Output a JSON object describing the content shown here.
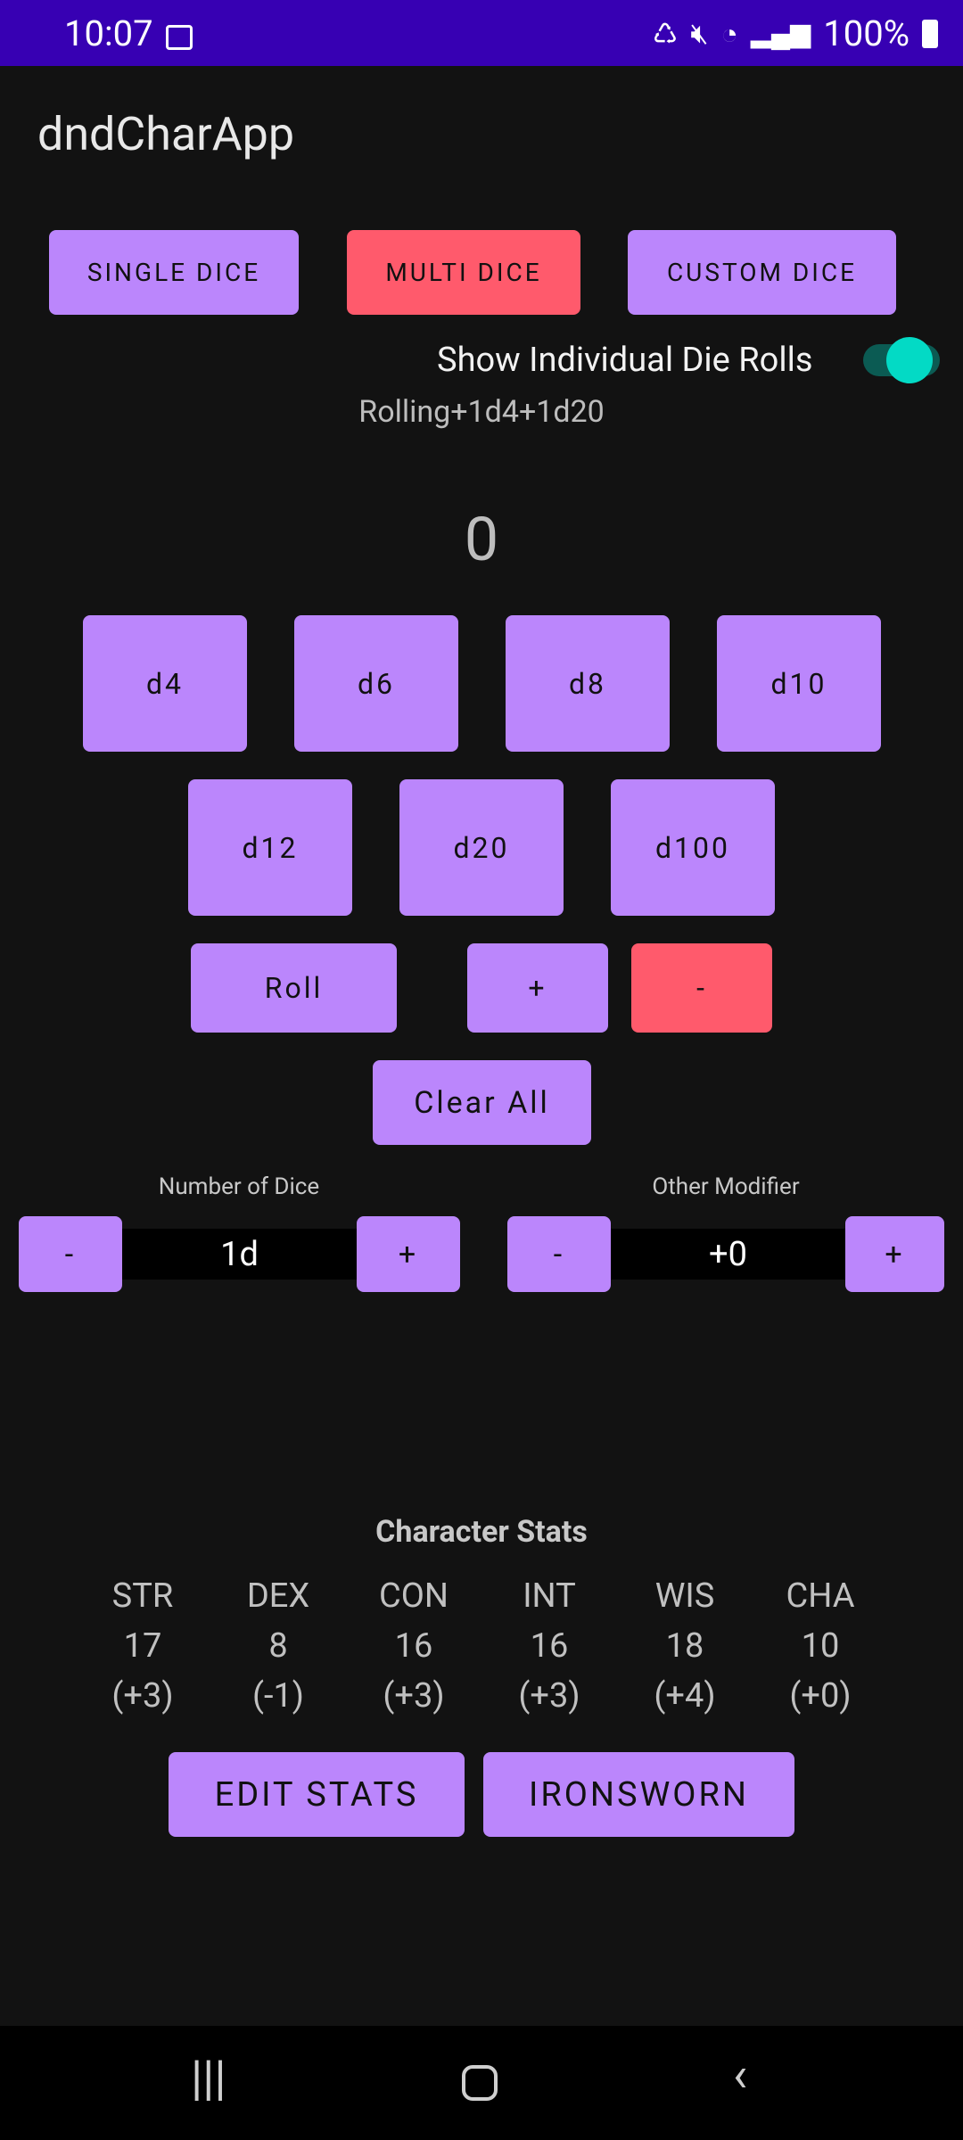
{
  "status_bar": {
    "time": "10:07",
    "battery": "100%"
  },
  "app": {
    "title": "dndCharApp"
  },
  "mode_tabs": {
    "single": "SINGLE DICE",
    "multi": "MULTI DICE",
    "custom": "CUSTOM DICE"
  },
  "toggle": {
    "label": "Show Individual Die Rolls",
    "on": true
  },
  "rolling_text": "Rolling+1d4+1d20",
  "result": "0",
  "dice": [
    "d4",
    "d6",
    "d8",
    "d10",
    "d12",
    "d20",
    "d100"
  ],
  "actions": {
    "roll": "Roll",
    "plus": "+",
    "minus": "-",
    "clear": "Clear All"
  },
  "number_of_dice": {
    "label": "Number of Dice",
    "value": "1d",
    "dec": "-",
    "inc": "+"
  },
  "other_modifier": {
    "label": "Other Modifier",
    "value": "+0",
    "dec": "-",
    "inc": "+"
  },
  "stats": {
    "title": "Character Stats",
    "items": [
      {
        "name": "STR",
        "score": "17",
        "mod": "(+3)"
      },
      {
        "name": "DEX",
        "score": "8",
        "mod": "(-1)"
      },
      {
        "name": "CON",
        "score": "16",
        "mod": "(+3)"
      },
      {
        "name": "INT",
        "score": "16",
        "mod": "(+3)"
      },
      {
        "name": "WIS",
        "score": "18",
        "mod": "(+4)"
      },
      {
        "name": "CHA",
        "score": "10",
        "mod": "(+0)"
      }
    ],
    "edit_button": "EDIT STATS",
    "ironsworn_button": "IRONSWORN"
  },
  "colors": {
    "accent": "#BB86FC",
    "active": "#FF5A6C",
    "teal": "#03DAC5",
    "status_bar": "#3700B3"
  }
}
